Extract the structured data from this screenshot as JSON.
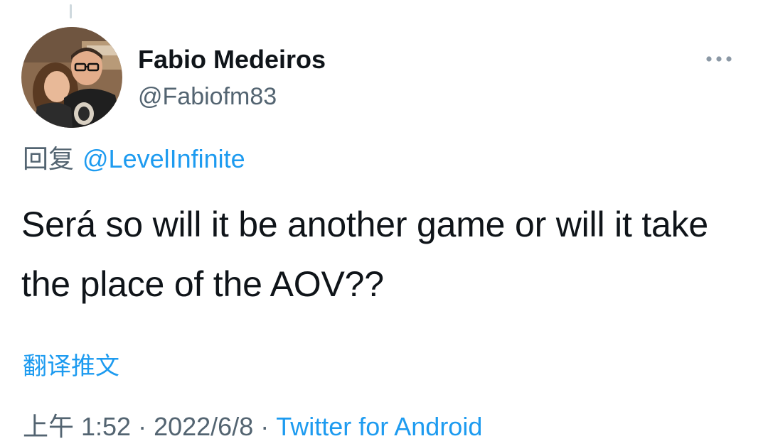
{
  "author": {
    "display_name": "Fabio Medeiros",
    "handle": "@Fabiofm83",
    "avatar_icon": "profile-photo"
  },
  "more_icon": "ellipsis-icon",
  "reply": {
    "prefix": "回复",
    "mention": "@LevelInfinite"
  },
  "tweet": {
    "text": "Será so will it be another game or will it take the place of the AOV??"
  },
  "translate_label": "翻译推文",
  "meta": {
    "time": "上午 1:52",
    "separator_1": "·",
    "date": "2022/6/8",
    "separator_2": "·",
    "source": "Twitter for Android"
  },
  "colors": {
    "accent": "#1d9bf0",
    "secondary_text": "#536471",
    "primary_text": "#0f1419"
  }
}
